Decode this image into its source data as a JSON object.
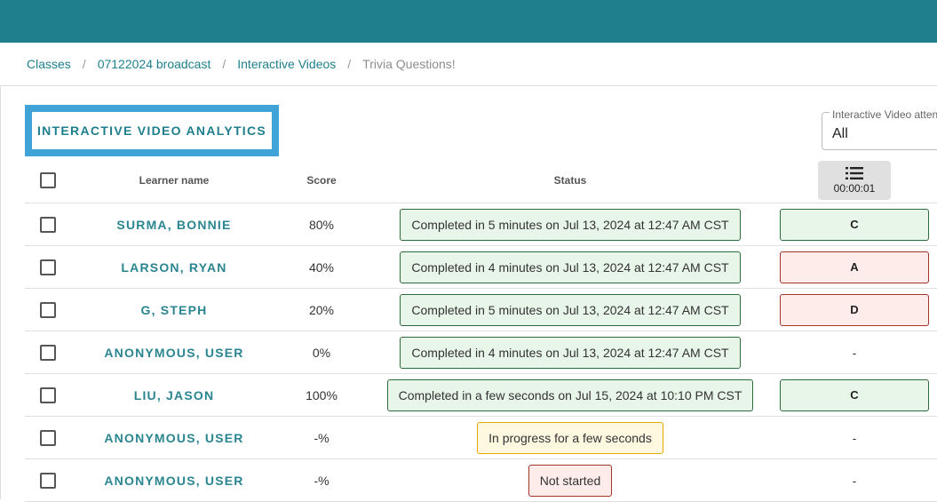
{
  "breadcrumb": {
    "items": [
      "Classes",
      "07122024 broadcast",
      "Interactive Videos"
    ],
    "current": "Trivia Questions!",
    "separator": "/"
  },
  "heading": "INTERACTIVE VIDEO ANALYTICS",
  "attempt_filter": {
    "label": "Interactive Video atten",
    "value": "All"
  },
  "table": {
    "headers": {
      "name": "Learner name",
      "score": "Score",
      "status": "Status"
    },
    "question_column": {
      "icon": "list-icon",
      "time": "00:00:01"
    },
    "rows": [
      {
        "name": "SURMA, BONNIE",
        "score": "80%",
        "status": "Completed in 5 minutes on Jul 13, 2024 at 12:47 AM CST",
        "status_type": "complete",
        "answer": "C",
        "answer_type": "correct"
      },
      {
        "name": "LARSON, RYAN",
        "score": "40%",
        "status": "Completed in 4 minutes on Jul 13, 2024 at 12:47 AM CST",
        "status_type": "complete",
        "answer": "A",
        "answer_type": "wrong"
      },
      {
        "name": "G, STEPH",
        "score": "20%",
        "status": "Completed in 5 minutes on Jul 13, 2024 at 12:47 AM CST",
        "status_type": "complete",
        "answer": "D",
        "answer_type": "wrong"
      },
      {
        "name": "ANONYMOUS, USER",
        "score": "0%",
        "status": "Completed in 4 minutes on Jul 13, 2024 at 12:47 AM CST",
        "status_type": "complete",
        "answer": "-",
        "answer_type": "none"
      },
      {
        "name": "LIU, JASON",
        "score": "100%",
        "status": "Completed in a few seconds on Jul 15, 2024 at 10:10 PM CST",
        "status_type": "complete",
        "answer": "C",
        "answer_type": "correct"
      },
      {
        "name": "ANONYMOUS, USER",
        "score": "-%",
        "status": "In progress for a few seconds",
        "status_type": "progress",
        "answer": "-",
        "answer_type": "none"
      },
      {
        "name": "ANONYMOUS, USER",
        "score": "-%",
        "status": "Not started",
        "status_type": "notstarted",
        "answer": "-",
        "answer_type": "none"
      }
    ]
  },
  "colors": {
    "topbar": "#1f7f8d",
    "accent": "#2a8590",
    "heading_border": "#3fa3d8"
  }
}
